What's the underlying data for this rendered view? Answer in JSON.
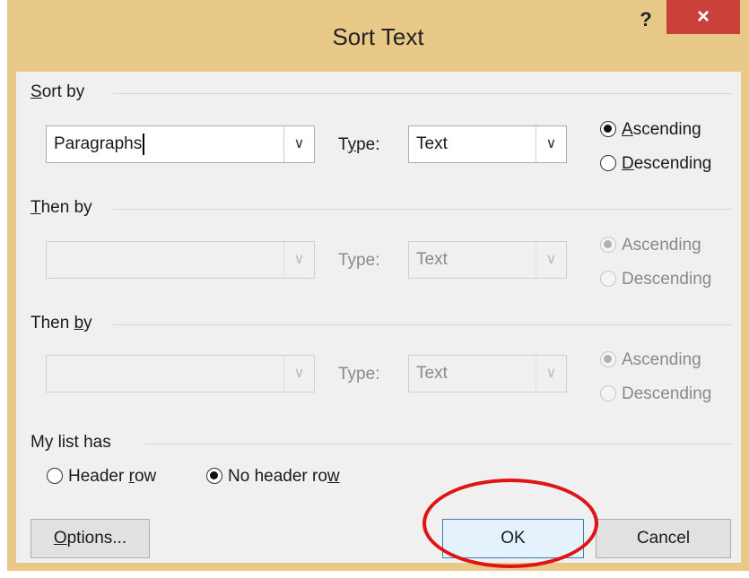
{
  "window": {
    "title": "Sort Text",
    "help_label": "?",
    "close_label": "×"
  },
  "sort_by": {
    "group_label_pre": "",
    "group_label_acc": "S",
    "group_label_post": "ort by",
    "field_value": "Paragraphs",
    "type_label_pre": "T",
    "type_label_acc": "y",
    "type_label_post": "pe:",
    "type_value": "Text",
    "ascending_acc": "A",
    "ascending_rest": "scending",
    "descending_acc": "D",
    "descending_rest": "escending",
    "selected": "ascending"
  },
  "then_by_1": {
    "group_label_acc": "T",
    "group_label_post": "hen by",
    "field_value": "",
    "type_label": "Type:",
    "type_value": "Text",
    "ascending_label": "Ascending",
    "descending_label": "Descending"
  },
  "then_by_2": {
    "group_label_pre": "Then ",
    "group_label_acc": "b",
    "group_label_post": "y",
    "field_value": "",
    "type_label": "Type:",
    "type_value": "Text",
    "ascending_label": "Ascending",
    "descending_label": "Descending"
  },
  "list_has": {
    "group_label": "My list has",
    "header_row_pre": "Header ",
    "header_row_acc": "r",
    "header_row_post": "ow",
    "no_header_row_pre": "No header ro",
    "no_header_row_acc": "w",
    "selected": "no_header_row"
  },
  "buttons": {
    "options_acc": "O",
    "options_rest": "ptions...",
    "ok": "OK",
    "cancel": "Cancel"
  },
  "icons": {
    "dropdown": "chevron-down-icon",
    "annotation": "red-ellipse-highlight"
  },
  "colors": {
    "title_bar": "#e9c987",
    "close_button": "#c9413a",
    "annotation": "#e01414",
    "default_button_border": "#3c7fb1"
  }
}
